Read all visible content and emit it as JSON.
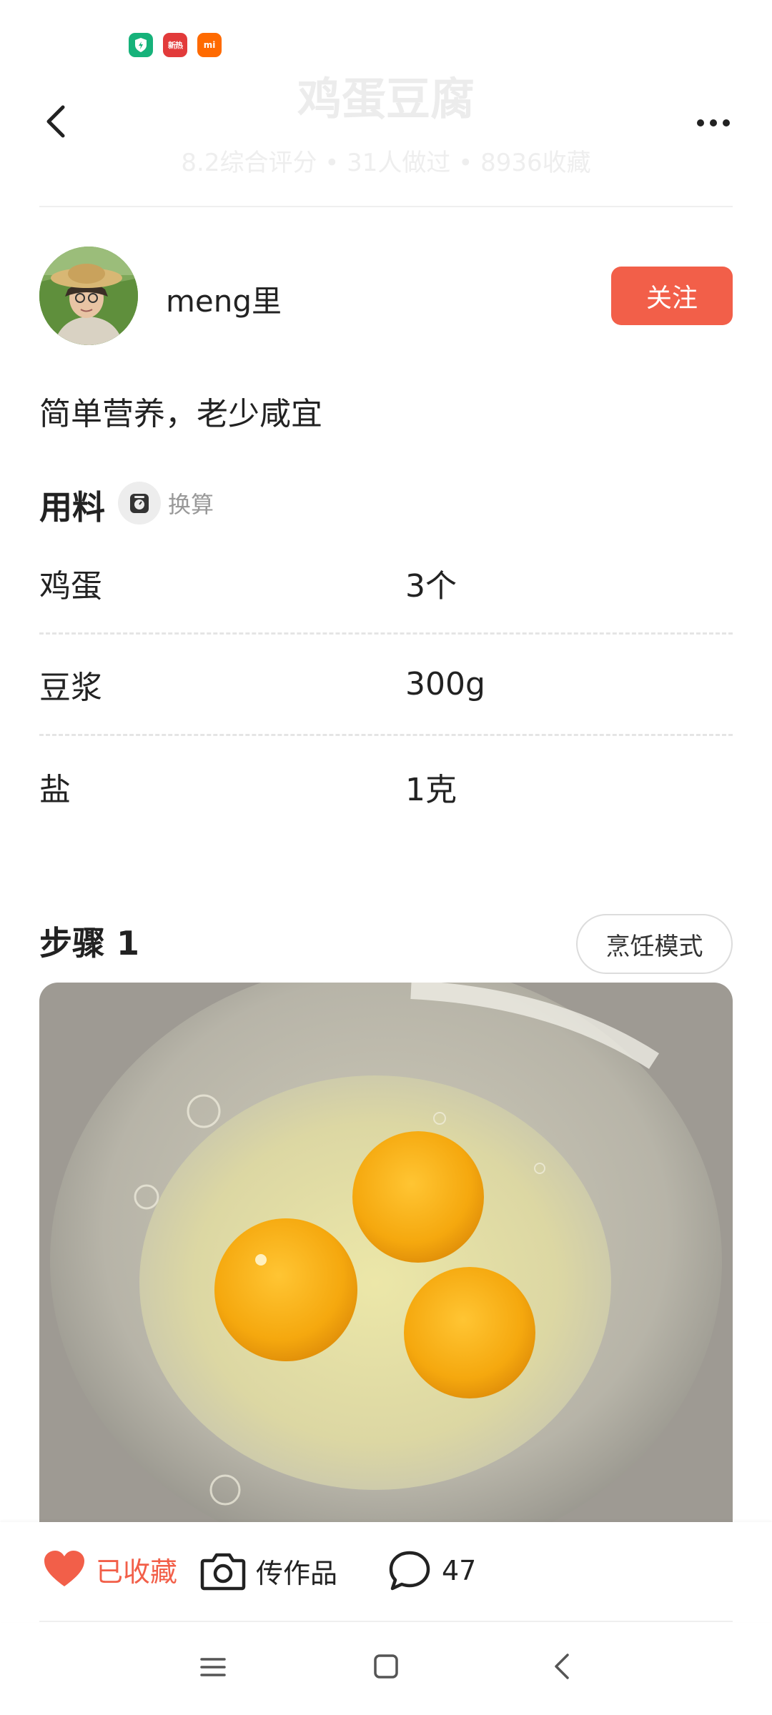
{
  "status_bar": {
    "icons": [
      {
        "name": "shield-app-icon",
        "text": "",
        "color": "#16b27a"
      },
      {
        "name": "news-app-icon",
        "text": "新热",
        "color": "#e23a3a"
      },
      {
        "name": "mi-app-icon",
        "text": "mi",
        "color": "#ff6a00"
      }
    ]
  },
  "header": {
    "title": "鸡蛋豆腐",
    "stats": "8.2综合评分 • 31人做过 • 8936收藏",
    "back_icon": "chevron-left-icon",
    "more_icon": "more-dots-icon"
  },
  "author": {
    "name": "meng里",
    "follow_label": "关注"
  },
  "description": "简单营养，老少咸宜",
  "ingredients": {
    "title": "用料",
    "scale_label": "换算",
    "items": [
      {
        "name": "鸡蛋",
        "amount": "3个"
      },
      {
        "name": "豆浆",
        "amount": "300g"
      },
      {
        "name": "盐",
        "amount": "1克"
      }
    ]
  },
  "step": {
    "title": "步骤 1",
    "cook_mode_label": "烹饪模式"
  },
  "action_bar": {
    "favorite_label": "已收藏",
    "upload_label": "传作品",
    "comment_count": "47"
  },
  "colors": {
    "accent": "#f25f49",
    "text": "#222222",
    "muted": "#999999"
  }
}
